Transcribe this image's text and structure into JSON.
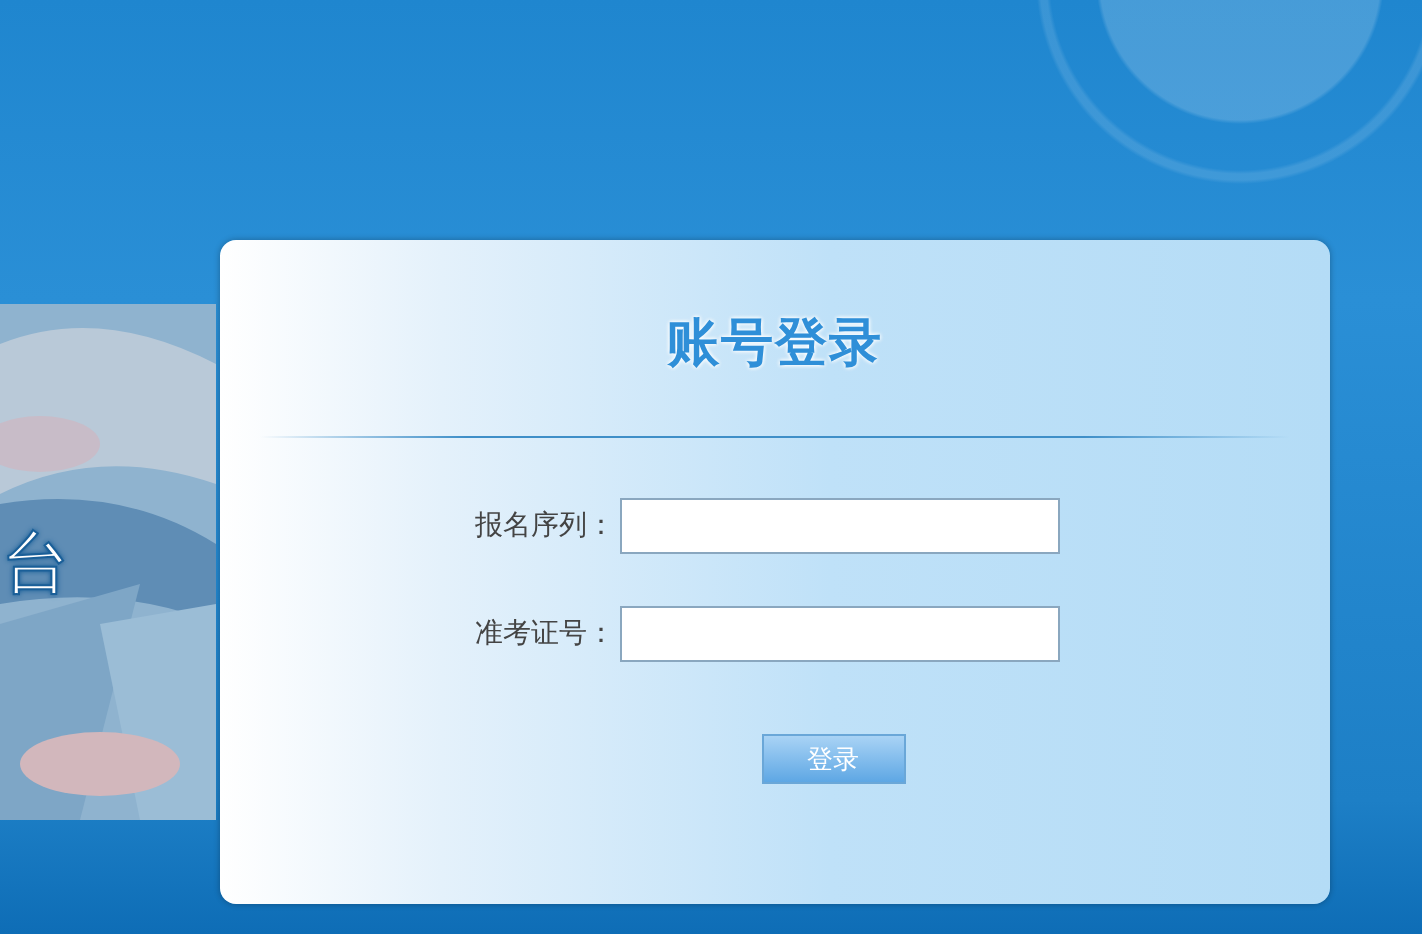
{
  "banner": {
    "kind": "picture",
    "text": "台"
  },
  "login": {
    "title": "账号登录",
    "fields": [
      {
        "label": "报名序列："
      },
      {
        "label": "准考证号："
      }
    ],
    "button": "登录"
  }
}
